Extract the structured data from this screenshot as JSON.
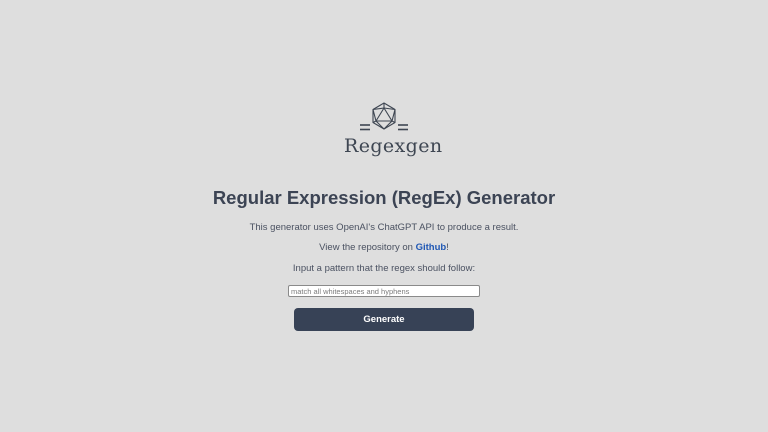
{
  "logo": {
    "text": "Regexgen",
    "icon": "icosahedron-icon"
  },
  "heading": "Regular Expression (RegEx) Generator",
  "intro": "This generator uses OpenAI's ChatGPT API to produce a result.",
  "repo": {
    "prefix": "View the repository on ",
    "link_label": "Github",
    "suffix": "!"
  },
  "prompt_label": "Input a pattern that the regex should follow:",
  "pattern_input": {
    "value": "",
    "placeholder": "match all whitespaces and hyphens"
  },
  "generate_label": "Generate",
  "colors": {
    "background": "#dedede",
    "text": "#3a4253",
    "link": "#1f57b4",
    "button": "#374256"
  }
}
